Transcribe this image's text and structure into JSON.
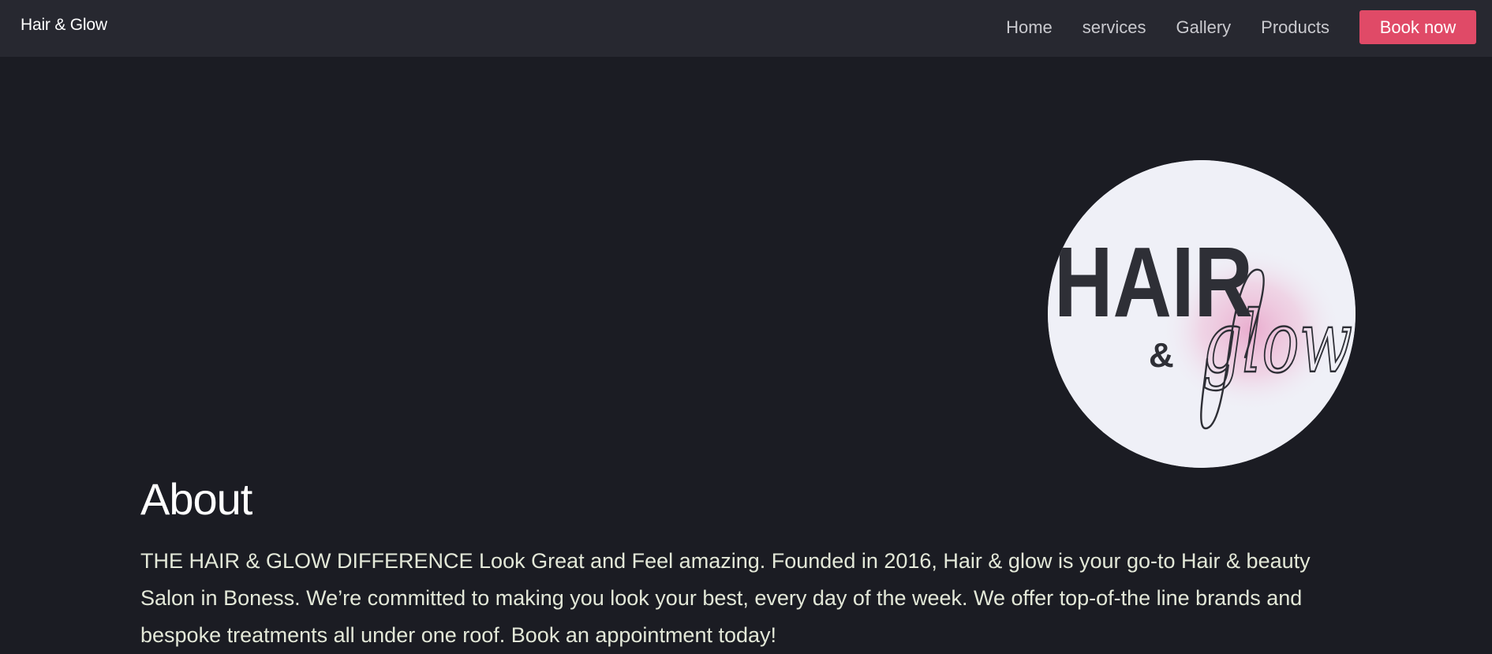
{
  "nav": {
    "brand": "Hair & Glow",
    "links": [
      {
        "label": "Home"
      },
      {
        "label": "services"
      },
      {
        "label": "Gallery"
      },
      {
        "label": "Products"
      }
    ],
    "cta": "Book now"
  },
  "hero": {
    "logo_text_main": "HAIR",
    "logo_text_amp": "&",
    "logo_text_script": "glow"
  },
  "about": {
    "title": "About",
    "text": "THE HAIR & GLOW DIFFERENCE Look Great and Feel amazing. Founded in 2016, Hair & glow is your go-to Hair & beauty Salon in Boness. We’re committed to making you look your best, every day of the week. We offer top-of-the line brands and bespoke treatments all under one roof. Book an appointment today!"
  },
  "colors": {
    "background": "#1b1c23",
    "navbar": "#272830",
    "accent": "#e04a67",
    "logo_bg": "#eff0f7",
    "logo_pink": "#e9a9cc"
  }
}
